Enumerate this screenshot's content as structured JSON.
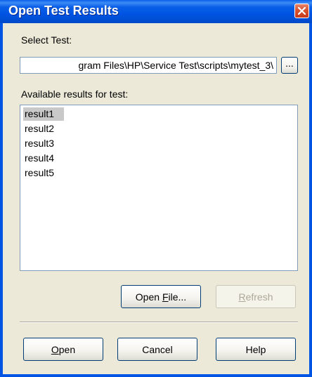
{
  "window": {
    "title": "Open Test Results"
  },
  "select_test": {
    "label": "Select Test:",
    "path_value": "gram Files\\HP\\Service Test\\scripts\\mytest_3\\",
    "browse_label": "..."
  },
  "results": {
    "label": "Available results for test:",
    "items": [
      "result1",
      "result2",
      "result3",
      "result4",
      "result5"
    ],
    "selected": "result1"
  },
  "buttons": {
    "open_file": {
      "before": "Open ",
      "mnemonic": "F",
      "after": "ile..."
    },
    "refresh": {
      "before": "",
      "mnemonic": "R",
      "after": "efresh"
    },
    "open": {
      "before": "",
      "mnemonic": "O",
      "after": "pen"
    },
    "cancel": "Cancel",
    "help": "Help"
  },
  "colors": {
    "titlebar": "#0054e3",
    "dialog_bg": "#ece9d8",
    "close_button": "#d8542f",
    "selection": "#c9c9c9"
  },
  "icons": {
    "close": "close-icon"
  }
}
